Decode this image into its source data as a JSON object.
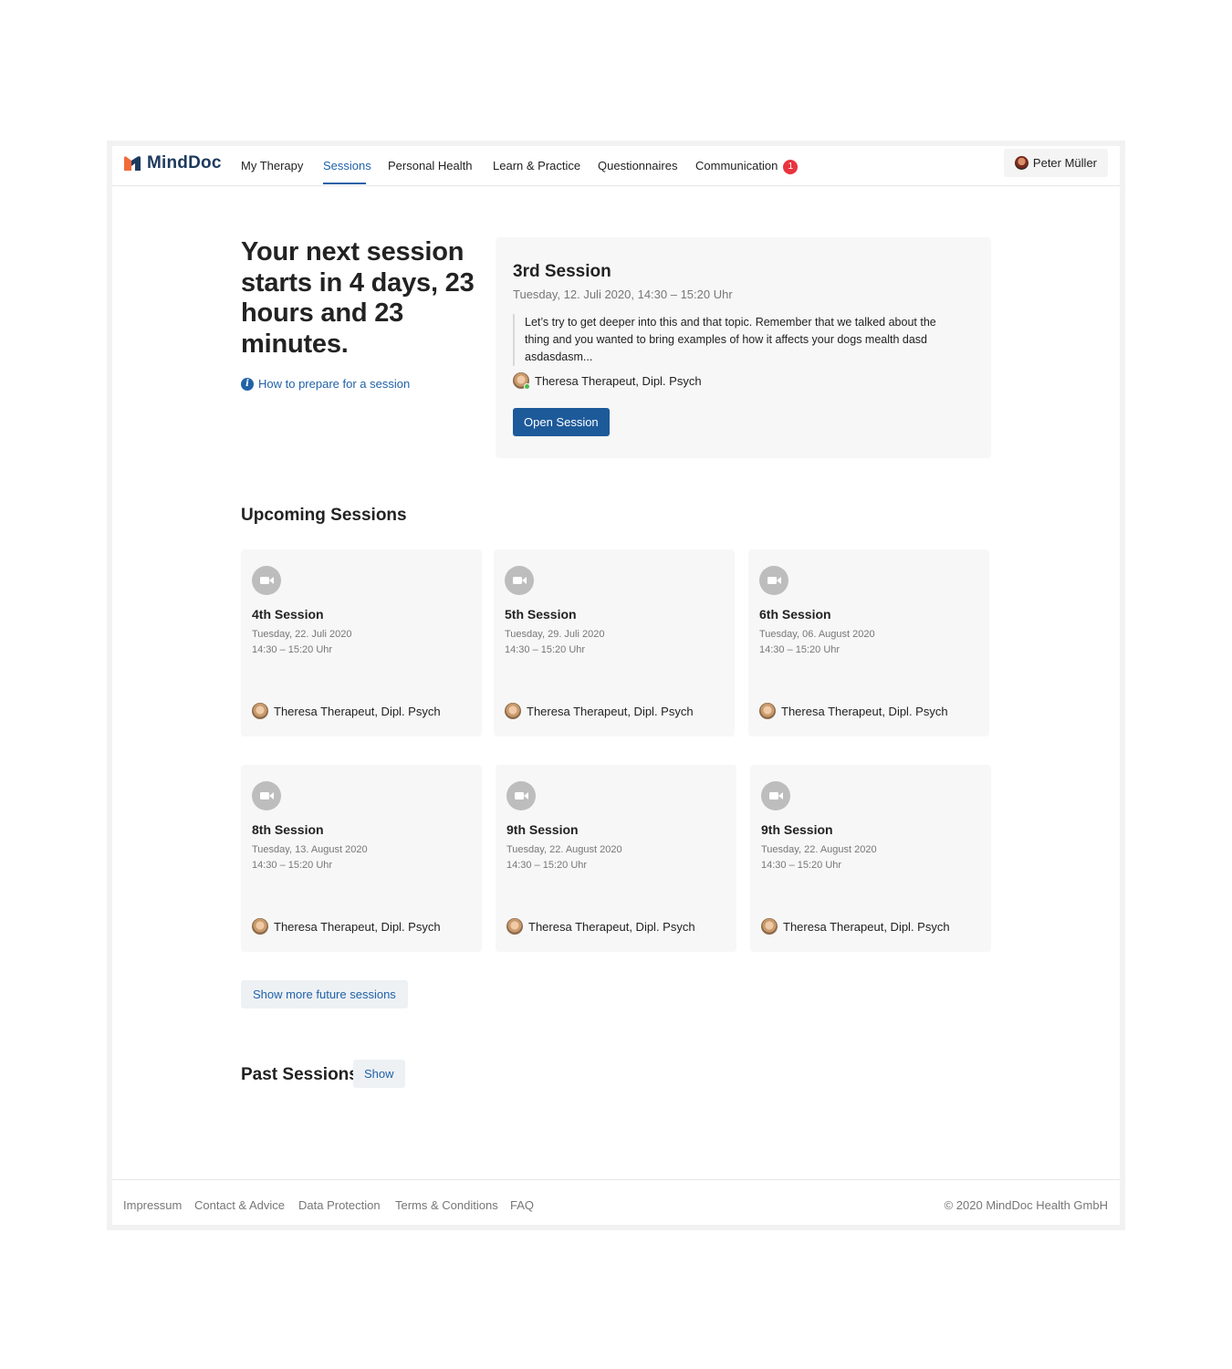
{
  "brand": {
    "name": "MindDoc",
    "colors": {
      "primary": "#1d5a9a",
      "link": "#2162a8",
      "badge": "#e8343f",
      "logo_orange": "#f26b3a",
      "logo_navy": "#1d3a5f"
    }
  },
  "nav": {
    "items": [
      {
        "label": "My Therapy"
      },
      {
        "label": "Sessions",
        "active": true
      },
      {
        "label": "Personal Health"
      },
      {
        "label": "Learn & Practice"
      },
      {
        "label": "Questionnaires"
      },
      {
        "label": "Communication",
        "badge": "1"
      }
    ],
    "user": {
      "name": "Peter Müller",
      "icon": "user-avatar"
    }
  },
  "hero": {
    "title": "Your next session starts in 4 days, 23 hours and 23 minutes.",
    "prepare_link": "How to prepare for a session",
    "prepare_icon": "info-icon"
  },
  "next_session": {
    "title": "3rd Session",
    "date": "Tuesday, 12. Juli 2020, 14:30 – 15:20 Uhr",
    "note": "Let’s try to get deeper into this and that topic. Remember that we talked about the thing and you wanted to bring examples of how it affects your dogs mealth dasd asdasdasm...",
    "therapist": "Theresa Therapeut, Dipl. Psych",
    "therapist_online": true,
    "button": "Open Session"
  },
  "upcoming": {
    "title": "Upcoming Sessions",
    "sessions": [
      {
        "title": "4th Session",
        "date": "Tuesday, 22. Juli 2020",
        "time": "14:30 – 15:20 Uhr",
        "therapist": "Theresa Therapeut, Dipl. Psych",
        "icon": "video-camera-icon"
      },
      {
        "title": "5th Session",
        "date": "Tuesday, 29. Juli 2020",
        "time": "14:30 – 15:20 Uhr",
        "therapist": "Theresa Therapeut, Dipl. Psych",
        "icon": "video-camera-icon"
      },
      {
        "title": "6th Session",
        "date": "Tuesday, 06. August 2020",
        "time": "14:30 – 15:20 Uhr",
        "therapist": "Theresa Therapeut, Dipl. Psych",
        "icon": "video-camera-icon"
      },
      {
        "title": "8th Session",
        "date": "Tuesday, 13. August 2020",
        "time": "14:30 – 15:20 Uhr",
        "therapist": "Theresa Therapeut, Dipl. Psych",
        "icon": "video-camera-icon"
      },
      {
        "title": "9th Session",
        "date": "Tuesday, 22. August 2020",
        "time": "14:30 – 15:20 Uhr",
        "therapist": "Theresa Therapeut, Dipl. Psych",
        "icon": "video-camera-icon"
      },
      {
        "title": "9th Session",
        "date": "Tuesday, 22. August 2020",
        "time": "14:30 – 15:20 Uhr",
        "therapist": "Theresa Therapeut, Dipl. Psych",
        "icon": "video-camera-icon"
      }
    ],
    "show_more": "Show more future sessions"
  },
  "past": {
    "title": "Past Sessions",
    "show_button": "Show"
  },
  "footer": {
    "links": [
      "Impressum",
      "Contact & Advice",
      "Data Protection",
      "Terms & Conditions",
      "FAQ"
    ],
    "copyright": "© 2020 MindDoc Health GmbH"
  }
}
